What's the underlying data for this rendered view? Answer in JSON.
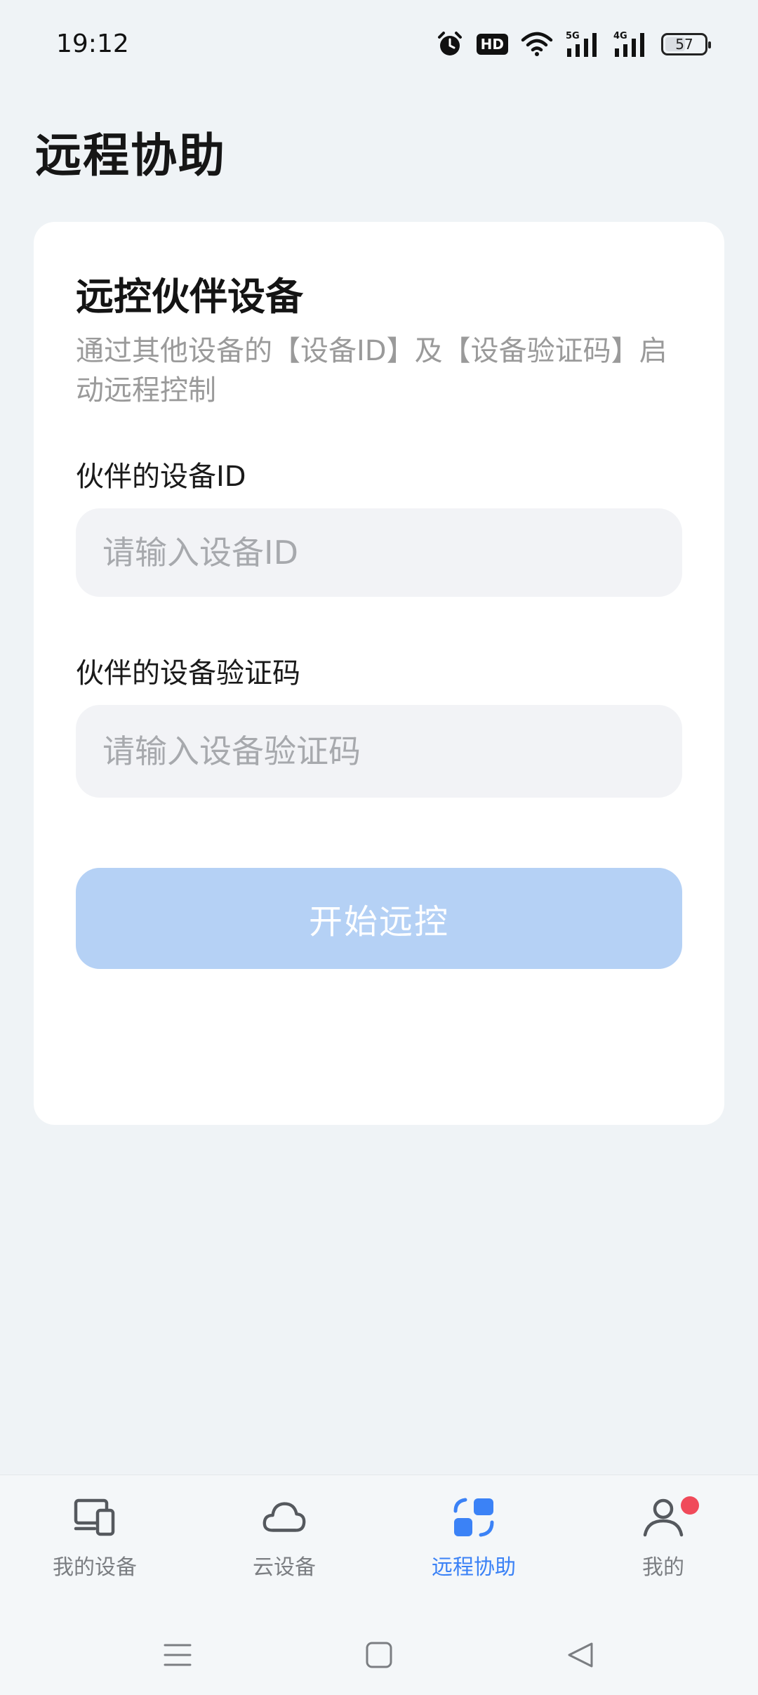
{
  "status_bar": {
    "time": "19:12",
    "hd_label": "HD",
    "signal1_label": "5G",
    "signal2_label": "4G",
    "battery_level": "57"
  },
  "page": {
    "title": "远程协助"
  },
  "card": {
    "title": "远控伙伴设备",
    "description": "通过其他设备的【设备ID】及【设备验证码】启动远程控制",
    "device_id_label": "伙伴的设备ID",
    "device_id_placeholder": "请输入设备ID",
    "device_id_value": "",
    "code_label": "伙伴的设备验证码",
    "code_placeholder": "请输入设备验证码",
    "code_value": "",
    "start_button": "开始远控"
  },
  "bottom_nav": {
    "items": [
      {
        "label": "我的设备",
        "icon": "devices-icon",
        "active": false
      },
      {
        "label": "云设备",
        "icon": "cloud-icon",
        "active": false
      },
      {
        "label": "远程协助",
        "icon": "remote-assist-icon",
        "active": true
      },
      {
        "label": "我的",
        "icon": "user-icon",
        "active": false,
        "badge": true
      }
    ]
  },
  "system_nav": {
    "icons": [
      "menu-icon",
      "home-icon",
      "back-icon"
    ]
  },
  "colors": {
    "accent": "#3b82f6",
    "button_disabled": "#b5d1f5",
    "background": "#eff3f6",
    "badge": "#f04a5a"
  }
}
